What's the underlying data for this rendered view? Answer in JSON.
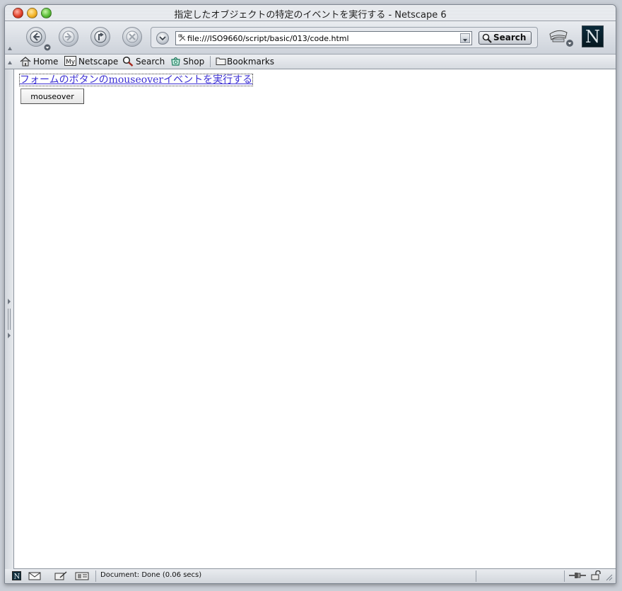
{
  "window": {
    "title": "指定したオブジェクトの特定のイベントを実行する - Netscape 6"
  },
  "nav": {
    "url": "file:///ISO9660/script/basic/013/code.html",
    "search_label": "Search",
    "logo_letter": "N"
  },
  "personal_toolbar": {
    "items": [
      {
        "label": "Home",
        "icon": "home-icon"
      },
      {
        "label": "Netscape",
        "icon": "my-netscape-icon"
      },
      {
        "label": "Search",
        "icon": "magnifier-icon"
      },
      {
        "label": "Shop",
        "icon": "shop-icon"
      },
      {
        "label": "Bookmarks",
        "icon": "folder-icon"
      }
    ]
  },
  "page": {
    "link_text": "フォームのボタンのmouseoverイベントを実行する",
    "button_label": "mouseover"
  },
  "status": {
    "text": "Document: Done (0.06 secs)"
  },
  "colors": {
    "link": "#3b2fd3",
    "window_chrome": "#dfe3e9"
  }
}
